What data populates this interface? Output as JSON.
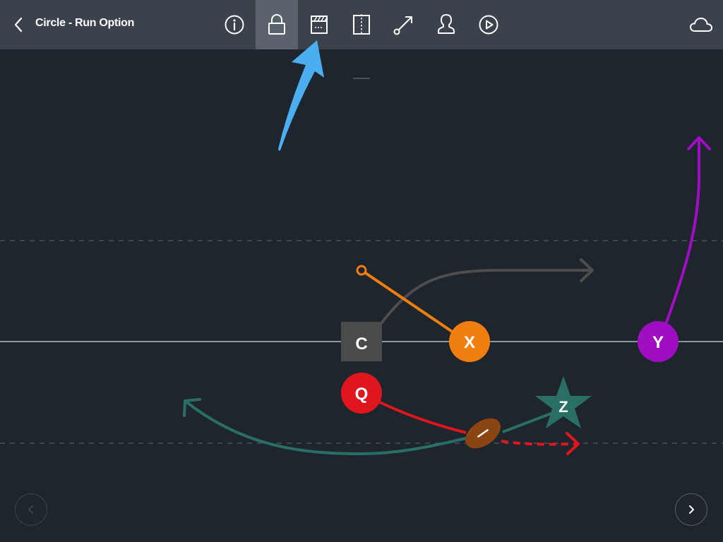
{
  "toolbar": {
    "title": "Circle - Run Option",
    "active_tool": "lock"
  },
  "tools": [
    {
      "name": "info-icon"
    },
    {
      "name": "lock-icon"
    },
    {
      "name": "clapperboard-icon"
    },
    {
      "name": "mirror-icon"
    },
    {
      "name": "route-icon"
    },
    {
      "name": "player-icon"
    },
    {
      "name": "play-icon"
    }
  ],
  "players": {
    "center": {
      "label": "C",
      "shape": "square",
      "color": "#4a4a4a"
    },
    "quarterback": {
      "label": "Q",
      "shape": "circle",
      "color": "#e0161e"
    },
    "x_receiver": {
      "label": "X",
      "shape": "circle",
      "color": "#f07f0f"
    },
    "y_receiver": {
      "label": "Y",
      "shape": "circle",
      "color": "#a00ec4"
    },
    "z_receiver": {
      "label": "Z",
      "shape": "star",
      "color": "#2a6f65"
    }
  },
  "colors": {
    "background": "#1f252d",
    "toolbar": "#3b424c",
    "line_of_scrimmage": "#8a95a0",
    "center_route": "#4d4d4d",
    "annotation_arrow": "#4aaef0",
    "football": "#8b4513"
  }
}
